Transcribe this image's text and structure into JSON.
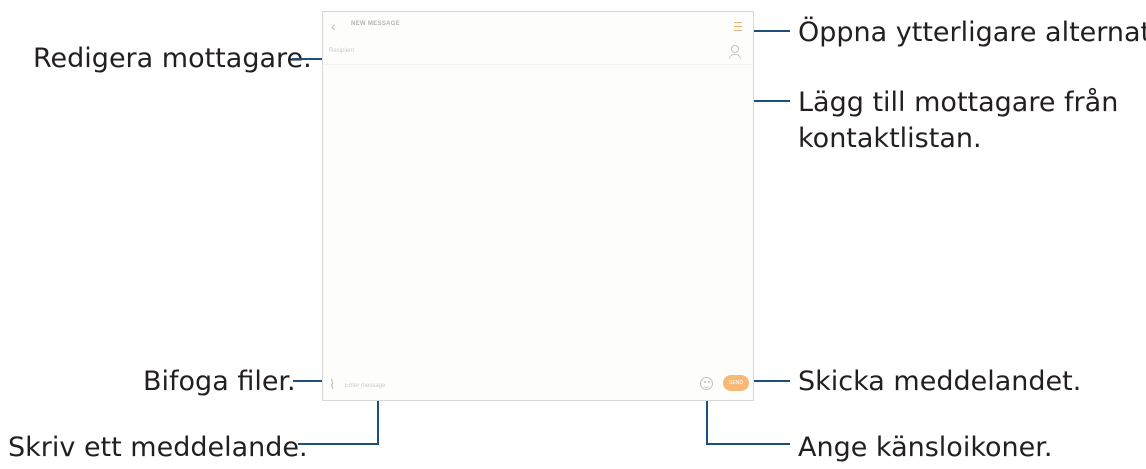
{
  "callouts": {
    "edit_recipients": "Redigera mottagare.",
    "more_options": "Öppna ytterligare alternativ.",
    "add_from_contacts_line1": "Lägg till mottagare från",
    "add_from_contacts_line2": "kontaktlistan.",
    "attach_files": "Bifoga filer.",
    "send_message": "Skicka meddelandet.",
    "write_message": "Skriv ett meddelande.",
    "emoticons": "Ange känsloikoner."
  },
  "screen": {
    "title": "NEW MESSAGE",
    "recipient_placeholder": "Recipient",
    "message_placeholder": "Enter message",
    "send_label": "SEND"
  },
  "colors": {
    "callout_line": "#1e4f7a",
    "accent": "#f7b976"
  }
}
